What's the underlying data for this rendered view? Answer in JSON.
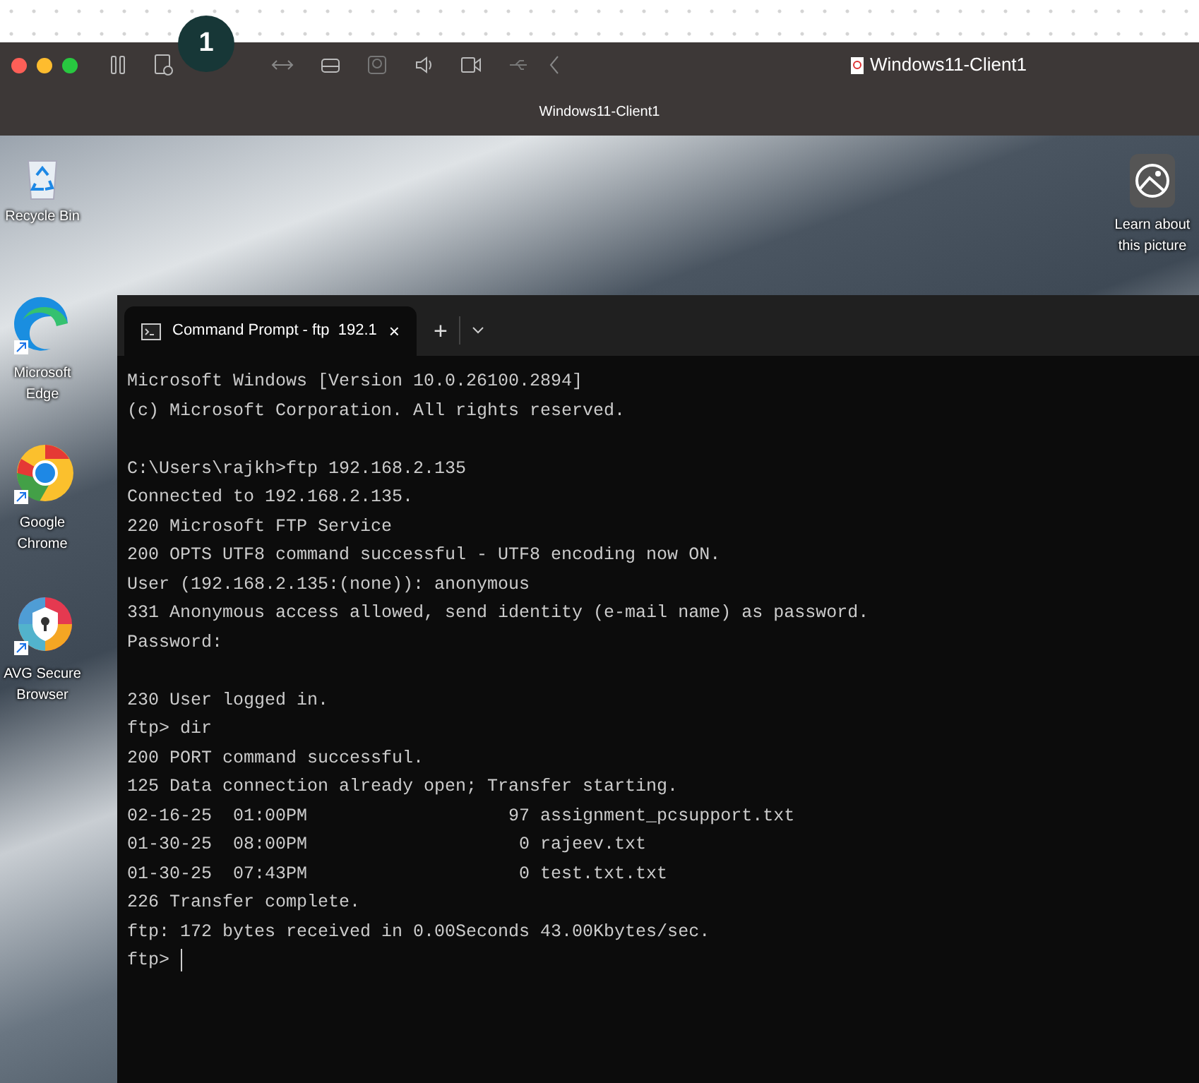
{
  "step_badge": "1",
  "toolbar": {
    "title": "Windows11-Client1"
  },
  "window": {
    "title": "Windows11-Client1"
  },
  "desktop_icons": [
    {
      "label": "Recycle Bin",
      "kind": "recycle"
    },
    {
      "label": "Learn about this picture",
      "kind": "learn"
    },
    {
      "label": "Microsoft Edge",
      "kind": "edge"
    },
    {
      "label": "Google Chrome",
      "kind": "chrome"
    },
    {
      "label": "AVG Secure Browser",
      "kind": "avg"
    }
  ],
  "terminal": {
    "tab": {
      "title": "Command Prompt - ftp  192.1",
      "close": "×",
      "selected": true
    },
    "new_tab": "+",
    "blocks": [
      [
        "Microsoft Windows [Version 10.0.26100.2894]",
        "(c) Microsoft Corporation. All rights reserved."
      ],
      [
        "C:\\Users\\rajkh>ftp 192.168.2.135",
        "Connected to 192.168.2.135.",
        "220 Microsoft FTP Service",
        "200 OPTS UTF8 command successful - UTF8 encoding now ON.",
        "User (192.168.2.135:(none)): anonymous",
        "331 Anonymous access allowed, send identity (e-mail name) as password.",
        "Password:"
      ],
      [
        "230 User logged in.",
        "ftp> dir",
        "200 PORT command successful.",
        "125 Data connection already open; Transfer starting.",
        "02-16-25  01:00PM                   97 assignment_pcsupport.txt",
        "01-30-25  08:00PM                    0 rajeev.txt",
        "01-30-25  07:43PM                    0 test.txt.txt",
        "226 Transfer complete.",
        "ftp: 172 bytes received in 0.00Seconds 43.00Kbytes/sec.",
        "ftp> "
      ]
    ]
  }
}
